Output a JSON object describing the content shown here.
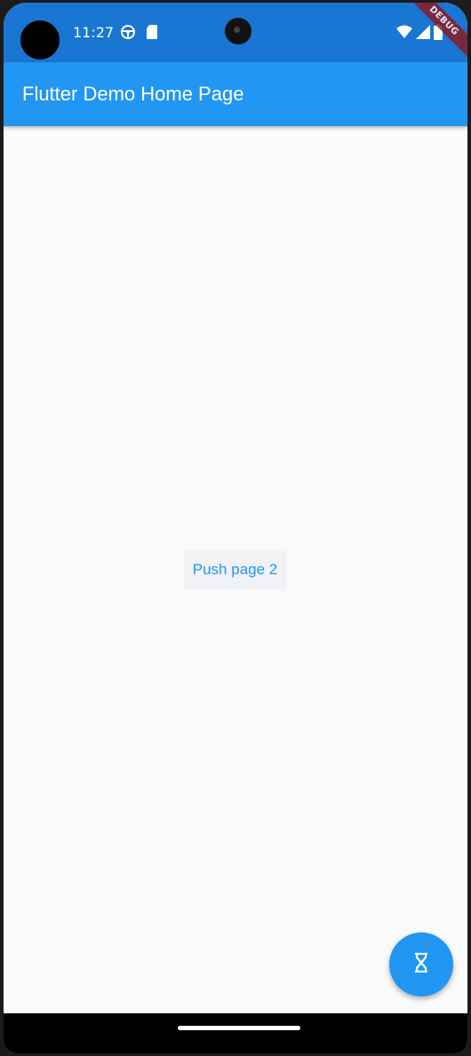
{
  "status_bar": {
    "time": "11:27",
    "icons": [
      "steering-wheel-icon",
      "sd-card-icon",
      "wifi-icon",
      "cell-signal-icon",
      "battery-icon"
    ]
  },
  "debug_banner": {
    "label": "DEBUG"
  },
  "app_bar": {
    "title": "Flutter Demo Home Page"
  },
  "main": {
    "push_button_label": "Push page 2"
  },
  "fab": {
    "icon": "hourglass-icon"
  },
  "colors": {
    "primary": "#2196f3",
    "status_bar": "#1976d2",
    "background": "#fafafa"
  }
}
